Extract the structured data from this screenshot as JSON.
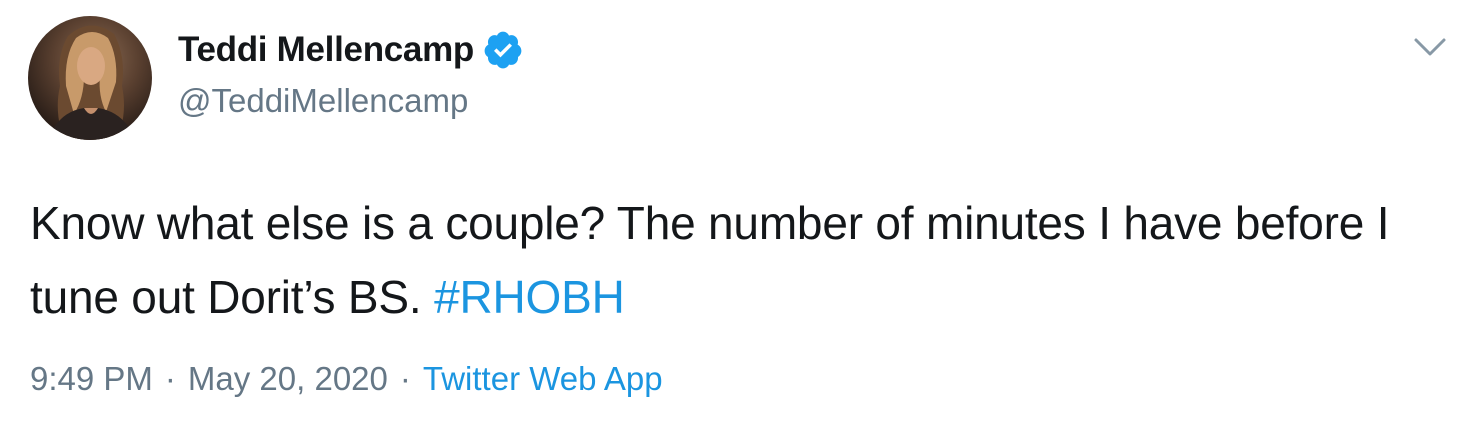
{
  "tweet": {
    "author": {
      "display_name": "Teddi Mellencamp",
      "handle": "@TeddiMellencamp",
      "verified": true
    },
    "text_main": "Know what else is a couple? The number of minutes I have before I tune out Dorit’s BS.",
    "hashtag": "#RHOBH",
    "time": "9:49 PM",
    "separator": "·",
    "date": "May 20, 2020",
    "source": "Twitter Web App"
  },
  "colors": {
    "accent": "#1b95e0",
    "secondary_text": "#657786",
    "primary_text": "#14171a",
    "verified_badge": "#1da1f2"
  },
  "icons": {
    "verified": "verified-badge-icon",
    "menu": "chevron-down-icon"
  }
}
